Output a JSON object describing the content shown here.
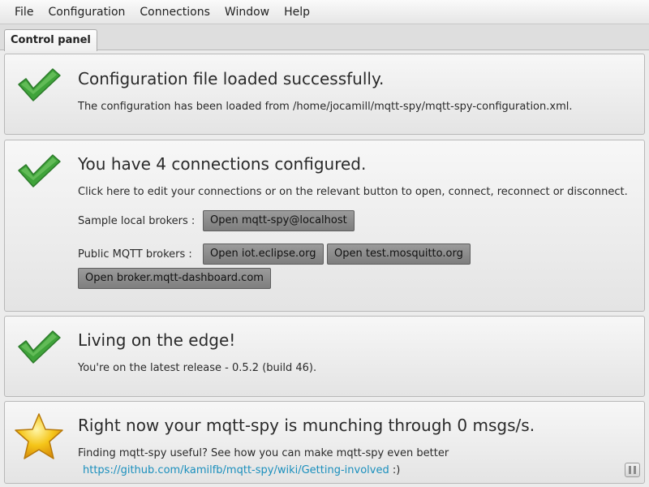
{
  "menubar": {
    "items": [
      "File",
      "Configuration",
      "Connections",
      "Window",
      "Help"
    ]
  },
  "tabs": [
    {
      "label": "Control panel",
      "active": true
    }
  ],
  "config_panel": {
    "icon": "checkmark-icon",
    "title": "Configuration file loaded successfully.",
    "message": "The configuration has been loaded from /home/jocamill/mqtt-spy/mqtt-spy-configuration.xml."
  },
  "connections_panel": {
    "icon": "checkmark-icon",
    "title": "You have 4 connections configured.",
    "message": "Click here to edit your connections or on the relevant button to open, connect, reconnect or disconnect.",
    "local_label": "Sample local brokers :",
    "local_buttons": [
      "Open mqtt-spy@localhost"
    ],
    "public_label": "Public MQTT brokers :",
    "public_buttons": [
      "Open iot.eclipse.org",
      "Open test.mosquitto.org",
      "Open broker.mqtt-dashboard.com"
    ]
  },
  "version_panel": {
    "icon": "checkmark-icon",
    "title": "Living on the edge!",
    "message": "You're on the latest release - 0.5.2 (build 46)."
  },
  "stats_panel": {
    "icon": "star-icon",
    "title": "Right now your mqtt-spy is munching through 0 msgs/s.",
    "message": "Finding mqtt-spy useful? See how you can make mqtt-spy even better",
    "link": "https://github.com/kamilfb/mqtt-spy/wiki/Getting-involved",
    "link_suffix": " :)"
  },
  "colors": {
    "check_green": "#3fa33a",
    "star_gold": "#f5c518",
    "link": "#1a8fbd",
    "button": "#8a8a8a"
  }
}
